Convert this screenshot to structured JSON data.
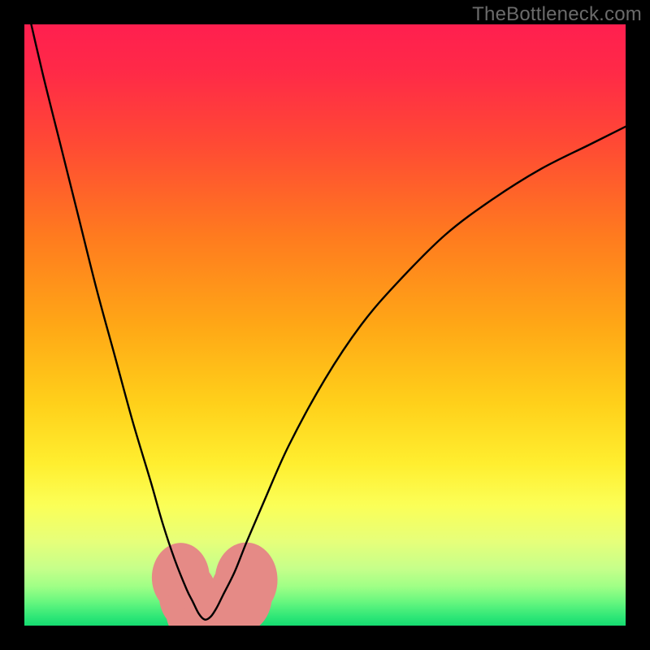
{
  "watermark": "TheBottleneck.com",
  "chart_data": {
    "type": "line",
    "title": "",
    "xlabel": "",
    "ylabel": "",
    "xlim": [
      0,
      100
    ],
    "ylim": [
      0,
      100
    ],
    "background_gradient_stops": [
      {
        "offset": 0.0,
        "color": "#ff1f4f"
      },
      {
        "offset": 0.08,
        "color": "#ff2a47"
      },
      {
        "offset": 0.2,
        "color": "#ff4a34"
      },
      {
        "offset": 0.35,
        "color": "#ff7a1f"
      },
      {
        "offset": 0.5,
        "color": "#ffa716"
      },
      {
        "offset": 0.63,
        "color": "#ffd01a"
      },
      {
        "offset": 0.73,
        "color": "#ffee2f"
      },
      {
        "offset": 0.8,
        "color": "#fbff57"
      },
      {
        "offset": 0.86,
        "color": "#e6ff7a"
      },
      {
        "offset": 0.905,
        "color": "#c6ff8a"
      },
      {
        "offset": 0.935,
        "color": "#9fff86"
      },
      {
        "offset": 0.96,
        "color": "#68f77f"
      },
      {
        "offset": 0.985,
        "color": "#2fe777"
      },
      {
        "offset": 1.0,
        "color": "#15db70"
      }
    ],
    "series": [
      {
        "name": "bottleneck-curve",
        "color": "#000000",
        "x": [
          0,
          3,
          6,
          9,
          12,
          15,
          18,
          21,
          23,
          25,
          27,
          28,
          29,
          30,
          31,
          32,
          33,
          35,
          37,
          40,
          44,
          50,
          56,
          62,
          70,
          78,
          86,
          94,
          100
        ],
        "y": [
          105,
          92,
          80,
          68,
          56,
          45,
          34,
          24,
          17,
          11,
          6,
          4,
          2,
          1,
          1.5,
          3,
          5,
          9,
          14,
          21,
          30,
          41,
          50,
          57,
          65,
          71,
          76,
          80,
          83
        ]
      }
    ],
    "markers": {
      "name": "highlight-blobs",
      "color": "#e58a86",
      "points": [
        {
          "x": 26.0,
          "y": 8.0,
          "r": 2.4
        },
        {
          "x": 27.2,
          "y": 5.0,
          "r": 2.4
        },
        {
          "x": 28.3,
          "y": 2.6,
          "r": 2.4
        },
        {
          "x": 29.4,
          "y": 1.2,
          "r": 2.2
        },
        {
          "x": 30.8,
          "y": 1.0,
          "r": 2.2
        },
        {
          "x": 32.2,
          "y": 1.0,
          "r": 2.2
        },
        {
          "x": 33.6,
          "y": 1.0,
          "r": 2.2
        },
        {
          "x": 36.0,
          "y": 5.0,
          "r": 2.6
        },
        {
          "x": 36.9,
          "y": 7.6,
          "r": 2.6
        }
      ]
    }
  }
}
